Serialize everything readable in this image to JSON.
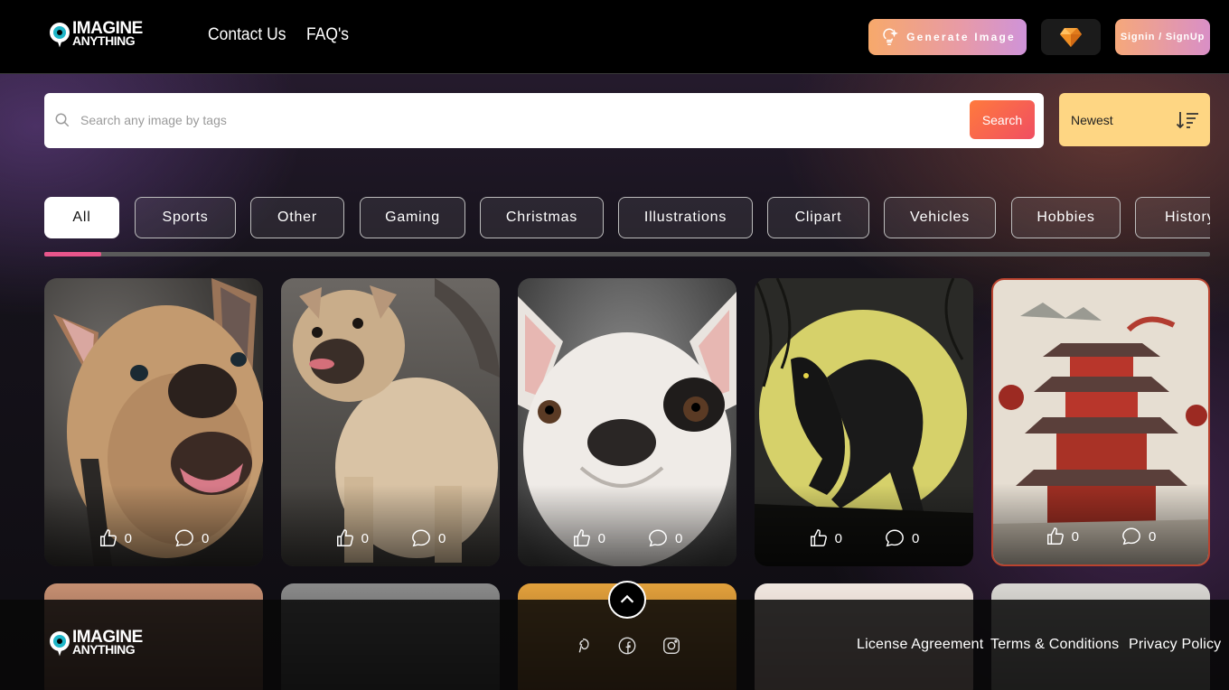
{
  "brand": {
    "line1": "IMAGINE",
    "line2": "ANYTHING"
  },
  "nav": {
    "contact": "Contact Us",
    "faq": "FAQ's"
  },
  "header": {
    "generate_label": "Generate Image",
    "sign_label": "Signin / SignUp",
    "gem_icon": "diamond-icon"
  },
  "search": {
    "placeholder": "Search any image by tags",
    "button": "Search"
  },
  "sort": {
    "label": "Newest",
    "icon": "sort-icon"
  },
  "tabs": [
    "All",
    "Sports",
    "Other",
    "Gaming",
    "Christmas",
    "Illustrations",
    "Clipart",
    "Vehicles",
    "Hobbies",
    "History"
  ],
  "active_tab": "All",
  "cards": [
    {
      "subject": "fawn french bulldog close-up",
      "likes": "0",
      "comments": "0"
    },
    {
      "subject": "fawn french bulldog standing",
      "likes": "0",
      "comments": "0"
    },
    {
      "subject": "white french bulldog with black eye patch",
      "likes": "0",
      "comments": "0"
    },
    {
      "subject": "werewolf under yellow moon",
      "likes": "0",
      "comments": "0"
    },
    {
      "subject": "red chinese pagoda painting",
      "likes": "0",
      "comments": "0"
    }
  ],
  "footer": {
    "links": [
      "License Agreement",
      "Terms & Conditions",
      "Privacy Policy"
    ],
    "social": [
      "pinterest-icon",
      "facebook-icon",
      "instagram-icon"
    ]
  },
  "colors": {
    "accent_pink": "#e8558b",
    "sort_bg": "#fed683",
    "search_btn": "#f45a52",
    "generate_from": "#f7a96b",
    "generate_to": "#cf93d9"
  }
}
